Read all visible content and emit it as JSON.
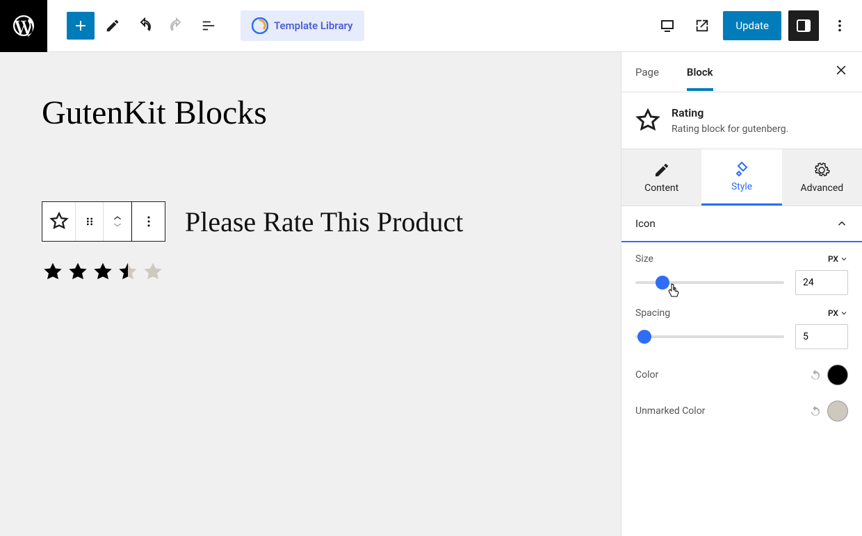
{
  "topbar": {
    "template_library": "Template Library",
    "update": "Update"
  },
  "canvas": {
    "title": "GutenKit Blocks",
    "rate_text": "Please Rate This Product",
    "rating_value": 3.5,
    "star_fill_color": "#000000",
    "star_empty_color": "#cec9bf"
  },
  "sidebar": {
    "tabs": {
      "page": "Page",
      "block": "Block"
    },
    "header": {
      "title": "Rating",
      "desc": "Rating block for gutenberg."
    },
    "sub_tabs": {
      "content": "Content",
      "style": "Style",
      "advanced": "Advanced"
    },
    "panel": {
      "title": "Icon",
      "size_label": "Size",
      "size_unit": "PX",
      "size_value": "24",
      "size_percent": 18,
      "spacing_label": "Spacing",
      "spacing_unit": "PX",
      "spacing_value": "5",
      "spacing_percent": 6,
      "color_label": "Color",
      "color_value": "#000000",
      "unmarked_label": "Unmarked Color",
      "unmarked_value": "#cec9bf"
    }
  }
}
